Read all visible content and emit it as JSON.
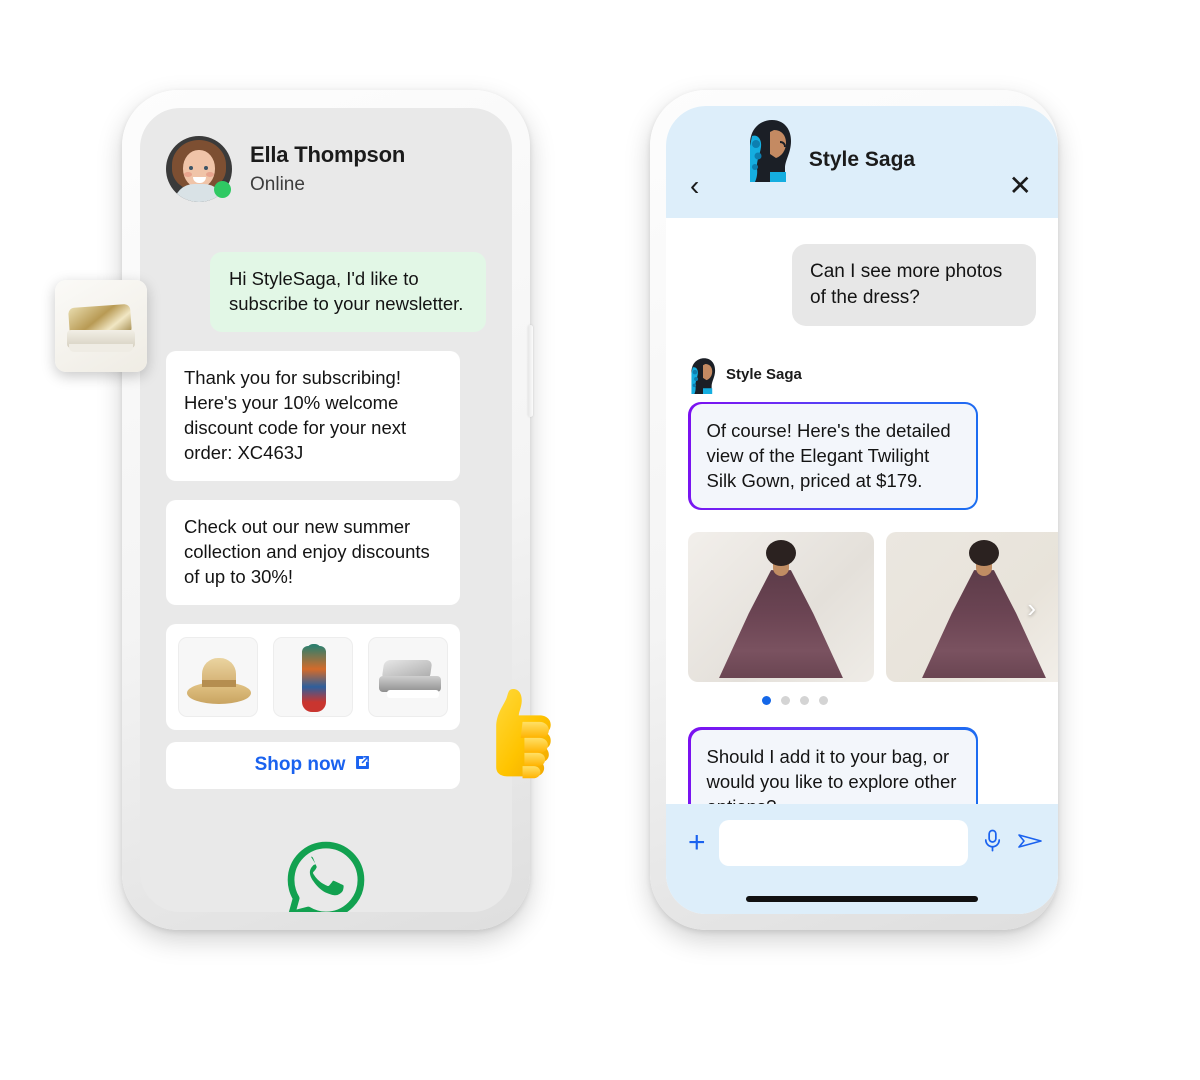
{
  "left_phone": {
    "contact": {
      "name": "Ella Thompson",
      "status": "Online",
      "avatar_icon": "woman-portrait-avatar",
      "online_dot_color": "#2fc963"
    },
    "messages": [
      {
        "id": "m1",
        "direction": "outgoing",
        "text": "Hi StyleSaga, I'd like to subscribe to your newsletter.",
        "bubble_color": "#e2f7e6"
      },
      {
        "id": "m2",
        "direction": "incoming",
        "text": "Thank you for subscribing! Here's your 10% welcome discount code for your next order: XC463J",
        "bubble_color": "#ffffff"
      },
      {
        "id": "m3",
        "direction": "incoming",
        "text": "Check out our new summer collection and enjoy discounts of up to 30%!",
        "bubble_color": "#ffffff"
      }
    ],
    "product_card": {
      "products": [
        {
          "name": "straw-fedora-hat",
          "label": "Straw hat"
        },
        {
          "name": "floral-maxi-dress",
          "label": "Floral dress"
        },
        {
          "name": "silver-platform-sandals",
          "label": "Silver sandals"
        }
      ],
      "cta_label": "Shop now",
      "cta_icon": "external-link-icon",
      "cta_color": "#1a62ef"
    },
    "brand_logo": {
      "icon": "whatsapp-logo-icon",
      "color": "#12a150"
    },
    "floating_thumbnail": {
      "icon": "gold-sandal-thumbnail"
    },
    "reaction_sticker": {
      "icon": "thumbs-up-emoji",
      "color": "#ffc107"
    }
  },
  "right_phone": {
    "header": {
      "title": "Style Saga",
      "avatar_icon": "ai-stylist-avatar",
      "back_icon": "chevron-left-icon",
      "close_icon": "close-x-icon",
      "background_color": "#ddeefa"
    },
    "messages": [
      {
        "id": "r1",
        "sender": "user",
        "text": "Can I see more photos of the dress?",
        "bubble_color": "#e7e7e7"
      },
      {
        "id": "r2",
        "sender": "bot",
        "sender_label": "Style Saga",
        "text": "Of course! Here's the detailed view of the Elegant Twilight Silk Gown, priced at $179.",
        "bubble_color": "#f3f6fb",
        "border_gradient": [
          "#7b0ff0",
          "#1a6ef0"
        ]
      },
      {
        "id": "r3",
        "sender": "bot",
        "text": "Should I add it to your bag, or would you like to explore other options?",
        "bubble_color": "#f3f6fb",
        "border_gradient": [
          "#7b0ff0",
          "#1a6ef0"
        ]
      }
    ],
    "carousel": {
      "slides": [
        {
          "name": "gown-front-view",
          "alt": "Model in plum silk gown front view"
        },
        {
          "name": "gown-back-view",
          "alt": "Model in plum silk gown back view"
        }
      ],
      "next_icon": "chevron-right-icon",
      "dots": 4,
      "active_dot": 0,
      "active_dot_color": "#1467e8",
      "inactive_dot_color": "#d4d4d4"
    },
    "input_bar": {
      "add_icon": "plus-icon",
      "input_value": "",
      "input_placeholder": "",
      "mic_icon": "microphone-icon",
      "send_icon": "send-paper-plane-icon",
      "accent_color": "#1a62ef",
      "background_color": "#ddeefa"
    },
    "home_indicator": "home-indicator-bar"
  }
}
